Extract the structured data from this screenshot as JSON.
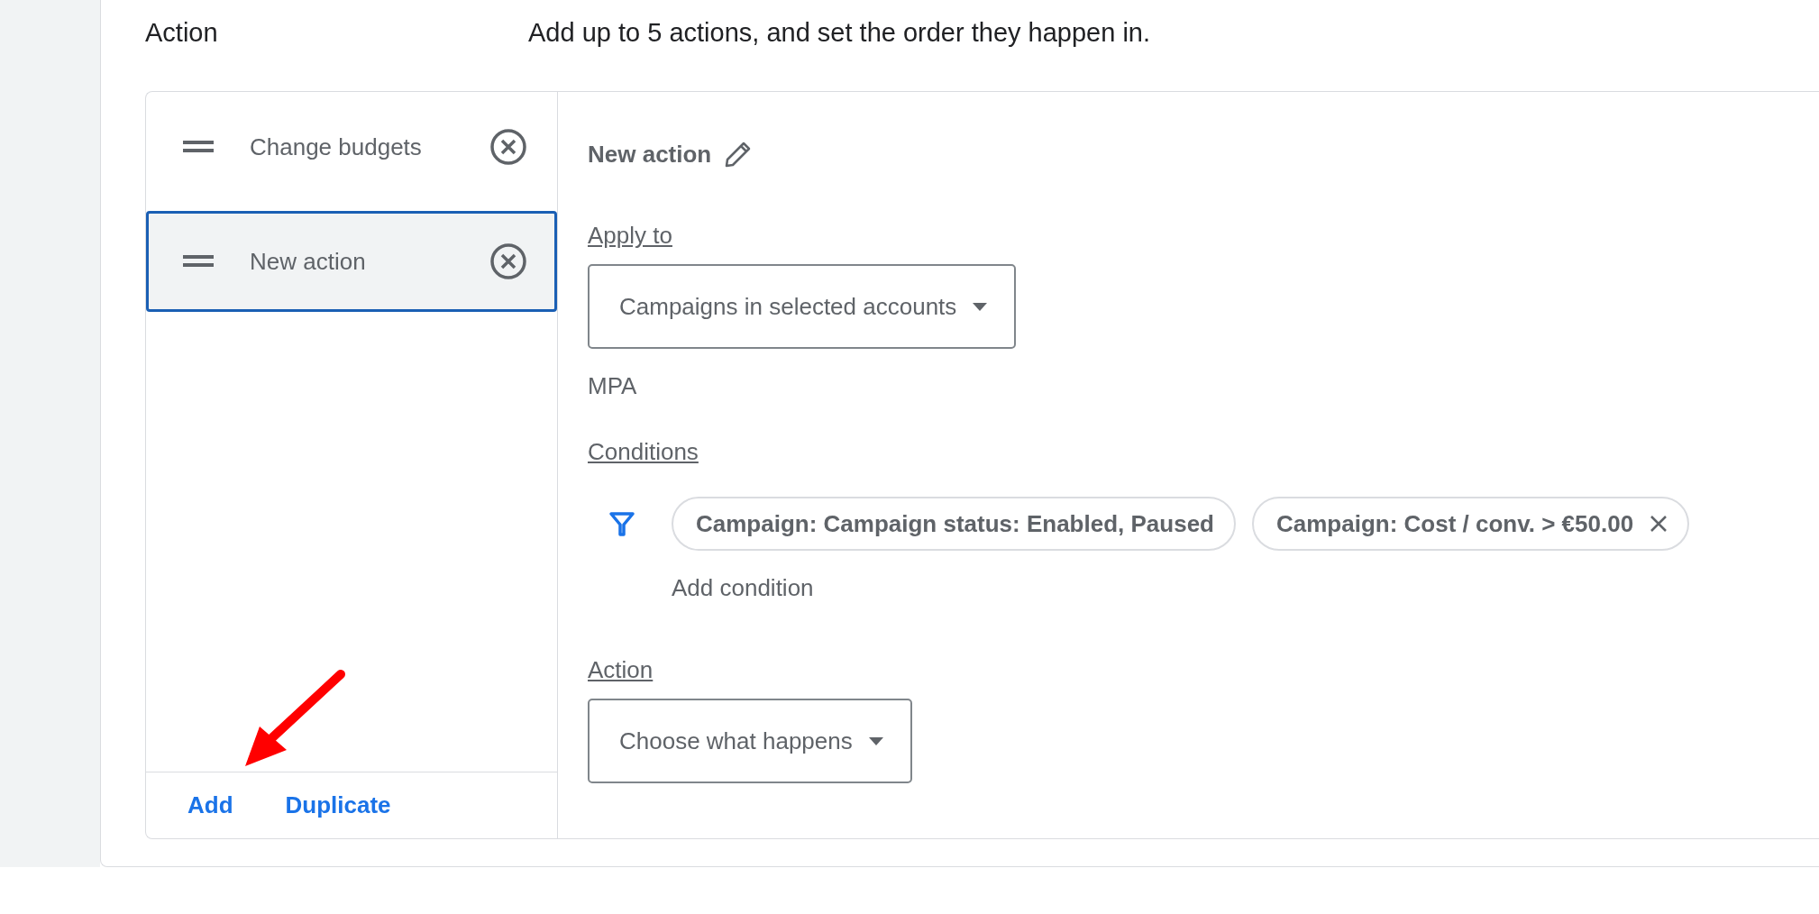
{
  "section": {
    "title": "Action",
    "description": "Add up to 5 actions, and set the order they happen in."
  },
  "actions": [
    {
      "label": "Change budgets",
      "selected": false
    },
    {
      "label": "New action",
      "selected": true
    }
  ],
  "footer_links": [
    "Add",
    "Duplicate"
  ],
  "editor": {
    "name": "New action",
    "apply_to": {
      "label": "Apply to",
      "value": "Campaigns in selected accounts",
      "note": "MPA"
    },
    "conditions": {
      "label": "Conditions",
      "chips": [
        {
          "text": "Campaign: Campaign status: Enabled, Paused",
          "removable": false
        },
        {
          "text": "Campaign: Cost / conv. > €50.00",
          "removable": true
        }
      ],
      "add": "Add condition"
    },
    "action": {
      "label": "Action",
      "value": "Choose what happens"
    }
  }
}
